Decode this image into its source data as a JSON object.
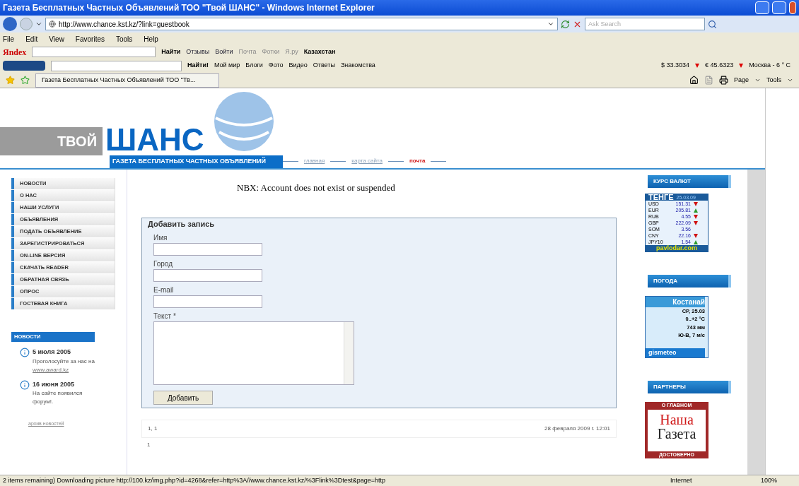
{
  "window": {
    "title": "Газета Бесплатных Частных Объявлений ТОО \"Твой ШАНС\" - Windows Internet Explorer"
  },
  "address": {
    "url": "http://www.chance.kst.kz/?link=guestbook",
    "search_placeholder": "Ask Search"
  },
  "menu": [
    "File",
    "Edit",
    "View",
    "Favorites",
    "Tools",
    "Help"
  ],
  "yandex_bar": {
    "logo": "Яndex",
    "search_button": "Найти",
    "items": [
      {
        "label": "Отзывы",
        "disabled": false
      },
      {
        "label": "Войти",
        "disabled": false
      },
      {
        "label": "Почта",
        "disabled": true
      },
      {
        "label": "Фотки",
        "disabled": true
      },
      {
        "label": "Я.ру",
        "disabled": true
      }
    ],
    "region": "Казахстан"
  },
  "mail_bar": {
    "search_button": "Найти!",
    "items": [
      "Мой мир",
      "Блоги",
      "Фото",
      "Видео",
      "Ответы",
      "Знакомства"
    ],
    "usd": "$ 33.3034",
    "eur": "€ 45.6323",
    "weather": "Москва - 6 ° C"
  },
  "tab": {
    "title": "Газета Бесплатных Частных Объявлений ТОО \"Тв...",
    "tools": [
      "Page",
      "Tools"
    ]
  },
  "header": {
    "logo_top": "ТВОЙ",
    "logo_main": "ШАНС",
    "logo_sub": "ГАЗЕТА БЕСПЛАТНЫХ ЧАСТНЫХ ОБЪЯВЛЕНИЙ",
    "nav": [
      {
        "label": "главная",
        "selected": false
      },
      {
        "label": "карта сайта",
        "selected": false
      },
      {
        "label": "почта",
        "selected": true
      }
    ]
  },
  "sidebar": {
    "items": [
      "НОВОСТИ",
      "О НАС",
      "НАШИ УСЛУГИ",
      "ОБЪЯВЛЕНИЯ",
      "ПОДАТЬ ОБЪЯВЛЕНИЕ",
      "ЗАРЕГИСТРИРОВАТЬСЯ",
      "ON-LINE ВЕРСИЯ",
      "СКАЧАТЬ READER",
      "ОБРАТНАЯ СВЯЗЬ",
      "ОПРОС",
      "ГОСТЕВАЯ КНИГА"
    ],
    "news_title": "НОВОСТИ",
    "news": [
      {
        "date": "5 июля 2005",
        "text": "Проголосуйте за нас на",
        "link": "www.award.kz"
      },
      {
        "date": "16 июня 2005",
        "text": "На сайте появился форум!."
      }
    ],
    "archive": "архив новостей"
  },
  "main": {
    "error": "NBX: Account does not exist or suspended",
    "form": {
      "title": "Добавить запись",
      "fields": [
        {
          "label": "Имя",
          "kind": "input"
        },
        {
          "label": "Город",
          "kind": "input"
        },
        {
          "label": "E-mail",
          "kind": "input"
        },
        {
          "label": "Текст *",
          "kind": "textarea"
        }
      ],
      "submit": "Добавить"
    },
    "footer": {
      "pages": "1, 1",
      "date": "28 февраля 2009 г. 12:01",
      "entry": "1"
    }
  },
  "right": {
    "currency_title": "КУРС ВАЛЮТ",
    "currency_widget": {
      "title": "ТЕНГЕ",
      "date": "25.03.09",
      "rows": [
        {
          "code": "USD",
          "value": "151.31",
          "kind": "down"
        },
        {
          "code": "EUR",
          "value": "205.81",
          "kind": "up"
        },
        {
          "code": "RUB",
          "value": "4.55",
          "kind": "down"
        },
        {
          "code": "GBP",
          "value": "222.09",
          "kind": "down"
        },
        {
          "code": "SOM",
          "value": "3.56",
          "kind": "flat"
        },
        {
          "code": "CNY",
          "value": "22.16",
          "kind": "down"
        },
        {
          "code": "JPY10",
          "value": "1.54",
          "kind": "up"
        }
      ],
      "source": "pavlodar.com"
    },
    "weather_title": "ПОГОДА",
    "weather": {
      "city": "Костанай",
      "lines": [
        "СР, 25.03",
        "0..+2 °C",
        "743 мм",
        "Ю-В, 7 м/с"
      ],
      "source": "gismeteo"
    },
    "partners_title": "ПАРТНЕРЫ",
    "partner": {
      "top": "О ГЛАВНОМ",
      "name1": "Наша",
      "name2": "Газета",
      "bottom": "ДОСТОВЕРНО"
    }
  },
  "status_bar": {
    "text": "2 items remaining) Downloading picture http://100.kz/img.php?id=4268&refer=http%3A//www.chance.kst.kz/%3Flink%3Dtest&page=http",
    "zone": "Internet",
    "zoom": "100%"
  }
}
